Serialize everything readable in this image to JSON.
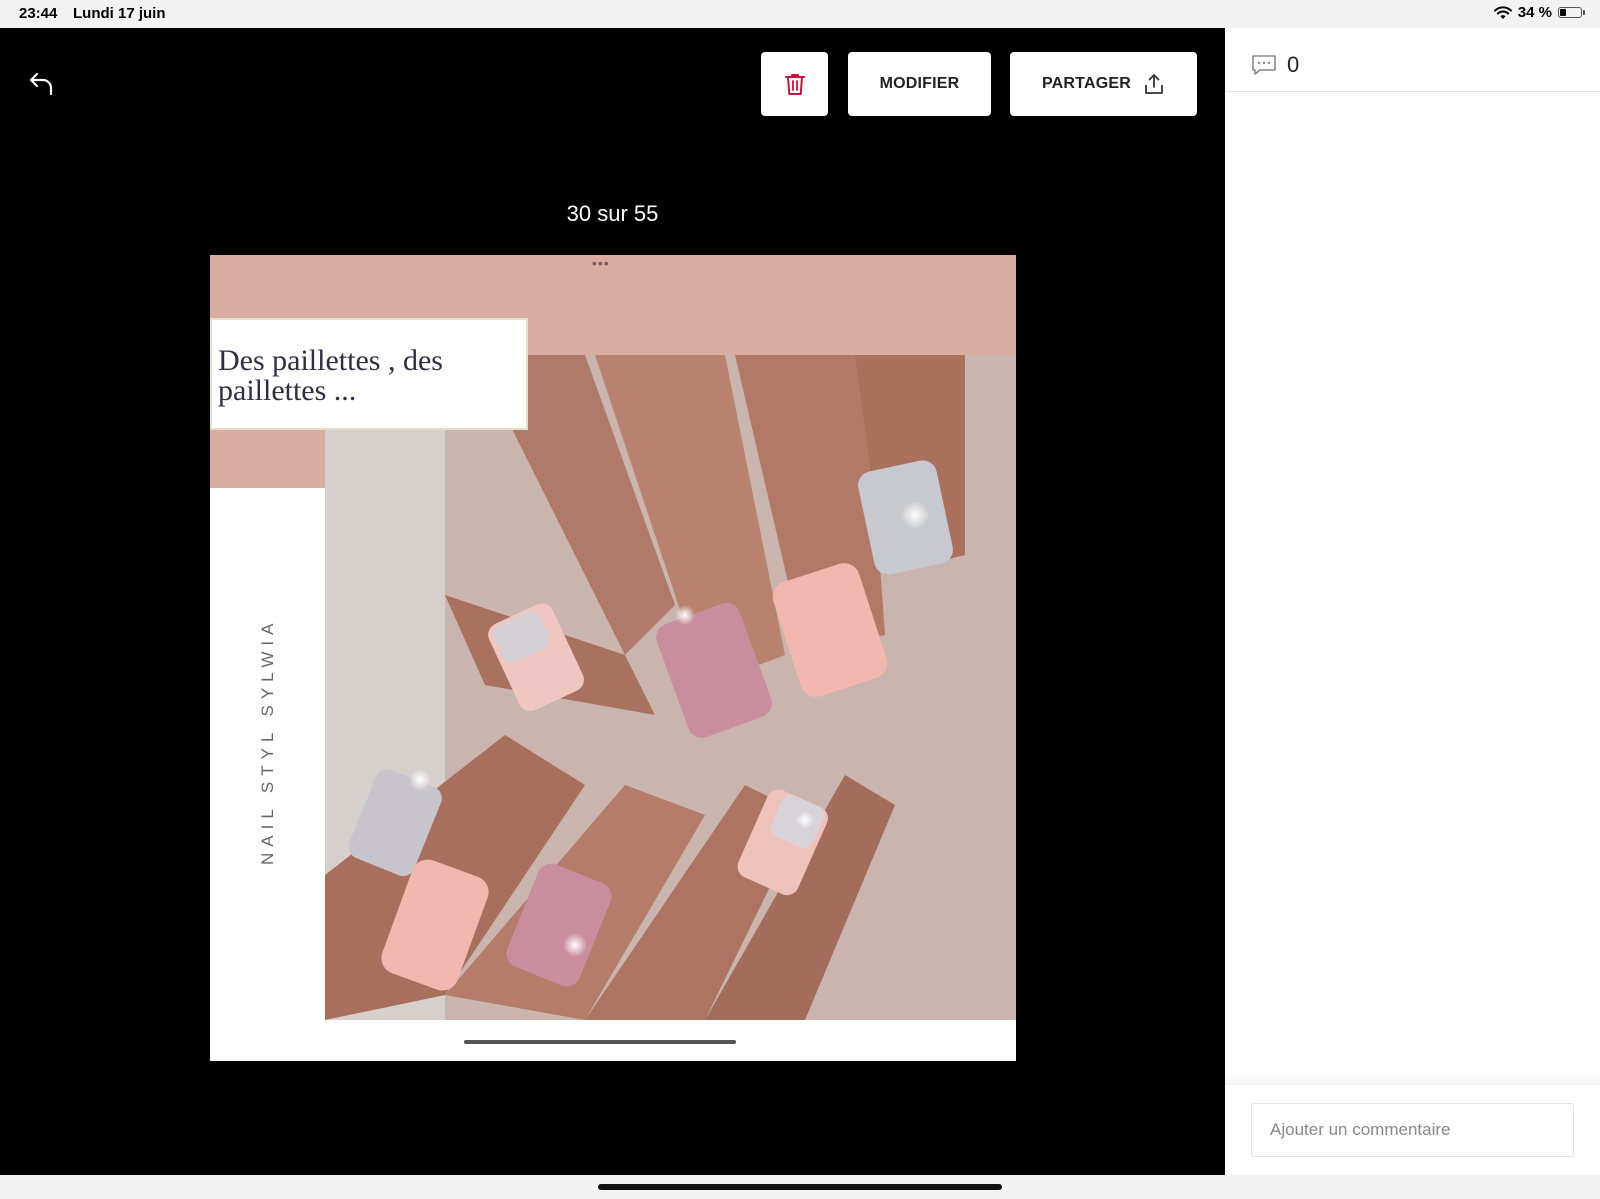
{
  "status_bar": {
    "time": "23:44",
    "date": "Lundi 17 juin",
    "battery": "34 %",
    "battery_level": 0.34
  },
  "toolbar": {
    "back_icon": "back-arrow-icon",
    "delete_icon": "trash-icon",
    "edit_label": "MODIFIER",
    "share_label": "PARTAGER",
    "share_icon": "share-upload-icon"
  },
  "viewer": {
    "counter": "30 sur 55"
  },
  "photo": {
    "title_text": "Des paillettes , des paillettes ...",
    "brand_text": "NAIL STYL SYLWIA",
    "menu_dots": "•••",
    "colors": {
      "band": "#d8ada0",
      "nail_pink": "#f2b8b0",
      "glitter": "#c8c8d0"
    }
  },
  "comments": {
    "icon": "comment-bubble-icon",
    "count": "0",
    "input_placeholder": "Ajouter un commentaire"
  },
  "colors": {
    "accent_delete": "#d0103a",
    "viewer_bg": "#000000",
    "panel_bg": "#ffffff"
  }
}
